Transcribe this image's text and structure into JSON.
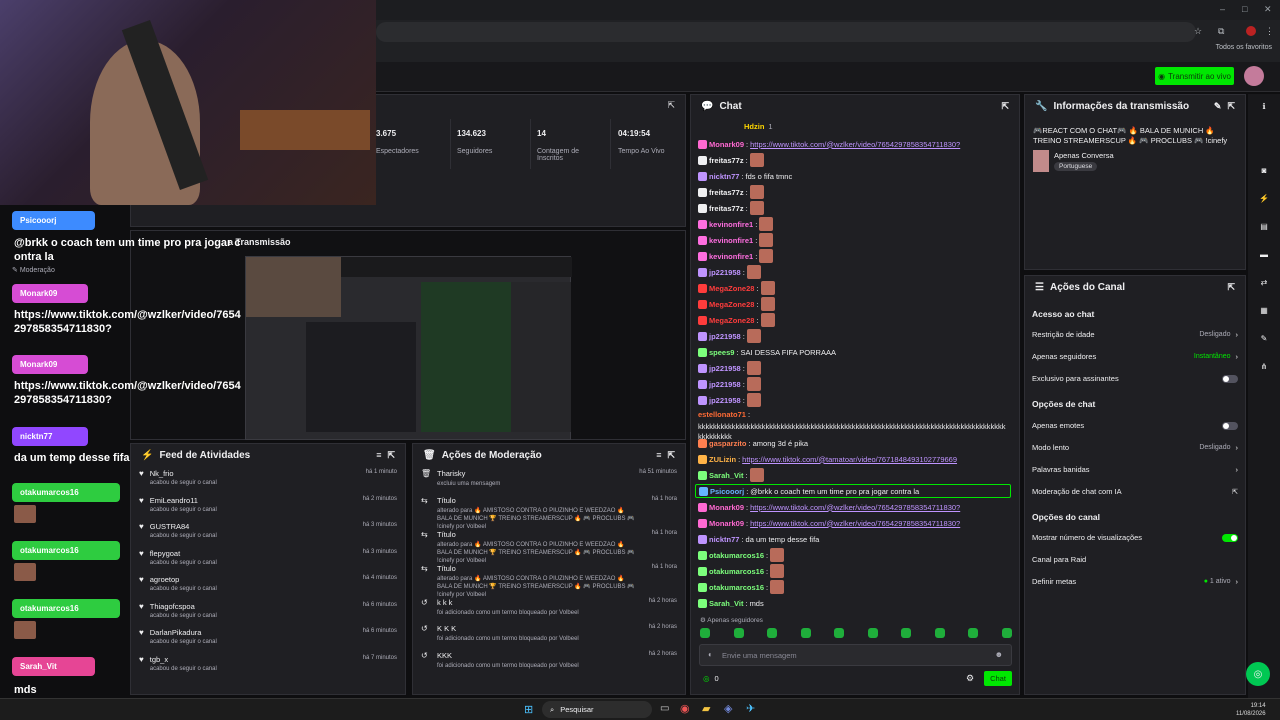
{
  "browser": {
    "bookmarks_label": "Todos os favoritos"
  },
  "appbar": {
    "live_button": "Transmitir ao vivo"
  },
  "stats": [
    {
      "value": "3.675",
      "label": "Espectadores"
    },
    {
      "value": "134.623",
      "label": "Seguidores"
    },
    {
      "value": "14",
      "label": "Contagem de Inscritos"
    },
    {
      "value": "04:19:54",
      "label": "Tempo Ao Vivo"
    }
  ],
  "preview": {
    "title": "a Transmissão",
    "mod_label": "Moderação"
  },
  "feed": {
    "title": "Feed de Atividades",
    "items": [
      {
        "name": "Nk_frio",
        "action": "acabou de seguir o canal",
        "time": "há 1 minuto"
      },
      {
        "name": "EmiLeandro11",
        "action": "acabou de seguir o canal",
        "time": "há 2 minutos"
      },
      {
        "name": "GUSTRA84",
        "action": "acabou de seguir o canal",
        "time": "há 3 minutos"
      },
      {
        "name": "flepygoat",
        "action": "acabou de seguir o canal",
        "time": "há 3 minutos"
      },
      {
        "name": "agroetop",
        "action": "acabou de seguir o canal",
        "time": "há 4 minutos"
      },
      {
        "name": "Thiagofcspoa",
        "action": "acabou de seguir o canal",
        "time": "há 6 minutos"
      },
      {
        "name": "DarlanPikadura",
        "action": "acabou de seguir o canal",
        "time": "há 6 minutos"
      },
      {
        "name": "tgb_x",
        "action": "acabou de seguir o canal",
        "time": "há 7 minutos"
      }
    ]
  },
  "moderation": {
    "title": "Ações de Moderação",
    "items": [
      {
        "name": "Tharisky",
        "detail": "excluiu uma mensagem",
        "time": "há 51 minutos"
      },
      {
        "name": "Título",
        "detail": "alterado para 🔥 AMISTOSO CONTRA O PIUZINHO E WEEDZAO 🔥 BALA DE MUNICH 🏆 TREINO STREAMERSCUP 🔥 🎮 PROCLUBS 🎮 !cinefy por Volbeel",
        "time": "há 1 hora"
      },
      {
        "name": "Título",
        "detail": "alterado para 🔥 AMISTOSO CONTRA O PIUZINHO E WEEDZAO 🔥 BALA DE MUNICH 🏆 TREINO STREAMERSCUP 🔥 🎮 PROCLUBS 🎮 !cinefy por Volbeel",
        "time": "há 1 hora"
      },
      {
        "name": "Título",
        "detail": "alterado para 🔥 AMISTOSO CONTRA O PIUZINHO E WEEDZAO 🔥 BALA DE MUNICH 🏆 TREINO STREAMERSCUP 🔥 🎮 PROCLUBS 🎮 !cinefy por Volbeel",
        "time": "há 1 hora"
      },
      {
        "name": "k k k",
        "detail": "foi adicionado como um termo bloqueado por Volbeel",
        "time": "há 2 horas"
      },
      {
        "name": "K K K",
        "detail": "foi adicionado como um termo bloqueado por Volbeel",
        "time": "há 2 horas"
      },
      {
        "name": "KKK",
        "detail": "foi adicionado como um termo bloqueado por Volbeel",
        "time": "há 2 horas"
      }
    ]
  },
  "chat": {
    "title": "Chat",
    "pinned_user": "Hdzin",
    "pinned_count": "1",
    "lines": [
      {
        "user": "Monark09",
        "color": "#ff69d2",
        "text": "https://www.tiktok.com/@wzlker/video/7654297858354711830?",
        "link": true
      },
      {
        "user": "freitas77z",
        "color": "#efeff1",
        "text": "",
        "emote": true
      },
      {
        "user": "nicktn77",
        "color": "#bf94ff",
        "text": "fds o fifa tmnc"
      },
      {
        "user": "freitas77z",
        "color": "#efeff1",
        "text": "",
        "emote": true
      },
      {
        "user": "freitas77z",
        "color": "#efeff1",
        "text": "",
        "emote": true
      },
      {
        "user": "kevinonfire1",
        "color": "#ff6ee0",
        "text": "",
        "emote": true
      },
      {
        "user": "kevinonfire1",
        "color": "#ff6ee0",
        "text": "",
        "emote": true
      },
      {
        "user": "kevinonfire1",
        "color": "#ff6ee0",
        "text": "",
        "emote": true
      },
      {
        "user": "jp221958",
        "color": "#bf94ff",
        "text": "",
        "emote": true
      },
      {
        "user": "MegaZone28",
        "color": "#ff3c3c",
        "text": "",
        "emote": true
      },
      {
        "user": "MegaZone28",
        "color": "#ff3c3c",
        "text": "",
        "emote": true
      },
      {
        "user": "MegaZone28",
        "color": "#ff3c3c",
        "text": "",
        "emote": true
      },
      {
        "user": "jp221958",
        "color": "#bf94ff",
        "text": "",
        "emote": true
      },
      {
        "user": "spees9",
        "color": "#7cff7c",
        "text": "SAI DESSA FIFA PORRAAA"
      },
      {
        "user": "jp221958",
        "color": "#bf94ff",
        "text": "",
        "emote": true
      },
      {
        "user": "jp221958",
        "color": "#bf94ff",
        "text": "",
        "emote": true
      },
      {
        "user": "jp221958",
        "color": "#bf94ff",
        "text": "",
        "emote": true
      }
    ],
    "lines2": [
      {
        "user": "gasparzito",
        "color": "#ff7f50",
        "text": "among 3d é pika"
      },
      {
        "user": "ZULizin",
        "color": "#ffb347",
        "text": "https://www.tiktok.com/@tamatoar/video/7671848493102779669",
        "link": true
      },
      {
        "user": "Sarah_Vit",
        "color": "#7cff7c",
        "text": "",
        "emote": true
      },
      {
        "user": "Psicooorj",
        "color": "#66b3ff",
        "text": "@brkk o coach tem um time pro pra jogar contra la",
        "highlight": true
      },
      {
        "user": "Monark09",
        "color": "#ff69d2",
        "text": "https://www.tiktok.com/@wzlker/video/7654297858354711830?",
        "link": true
      },
      {
        "user": "Monark09",
        "color": "#ff69d2",
        "text": "https://www.tiktok.com/@wzlker/video/7654297858354711830?",
        "link": true
      },
      {
        "user": "nicktn77",
        "color": "#bf94ff",
        "text": "da um temp desse fifa"
      },
      {
        "user": "otakumarcos16",
        "color": "#7cff7c",
        "text": "",
        "emote": true
      },
      {
        "user": "otakumarcos16",
        "color": "#7cff7c",
        "text": "",
        "emote": true
      },
      {
        "user": "otakumarcos16",
        "color": "#7cff7c",
        "text": "",
        "emote": true
      },
      {
        "user": "Sarah_Vit",
        "color": "#7cff7c",
        "text": "mds"
      }
    ],
    "spam_user": "estellonato71",
    "spam_text": "kkkkkkkkkkkkkkkkkkkkkkkkkkkkkkkkkkkkkkkkkkkkkkkkkkkkkkkkkkkkkkkkkkkkkkkkkkkkkkkkkkkkkkkkkkk",
    "followers_only": "Apenas seguidores",
    "input_placeholder": "Envie uma mensagem",
    "points": "0",
    "send_label": "Chat"
  },
  "stream_info": {
    "title": "Informações da transmissão",
    "stream_title": "🎮REACT COM O CHAT🎮 🔥 BALA DE MUNICH 🔥 TREINO STREAMERSCUP 🔥 🎮 PROCLUBS 🎮 !cinefy",
    "category": "Apenas Conversa",
    "language": "Portuguese"
  },
  "channel_actions": {
    "title": "Ações do Canal",
    "chat_access": "Acesso ao chat",
    "age_restriction": "Restrição de idade",
    "age_value": "Desligado",
    "followers_only": "Apenas seguidores",
    "followers_value": "Instantâneo",
    "subs_only": "Exclusivo para assinantes",
    "chat_options": "Opções de chat",
    "emotes_only": "Apenas emotes",
    "slow_mode": "Modo lento",
    "slow_value": "Desligado",
    "banned_words": "Palavras banidas",
    "ai_mod": "Moderação de chat com IA",
    "channel_options": "Opções do canal",
    "show_viewers": "Mostrar número de visualizações",
    "raid": "Canal para Raid",
    "goals": "Definir metas",
    "goals_value": "1 ativo"
  },
  "overlay": [
    {
      "name": "Psicooorj",
      "msg": "@brkk o coach tem um time pro pra jogar contra la",
      "color": "#3d8bff"
    },
    {
      "name": "Monark09",
      "msg": "https://www.tiktok.com/@wzlker/video/7654297858354711830?",
      "color": "#d64cd4"
    },
    {
      "name": "Monark09",
      "msg": "https://www.tiktok.com/@wzlker/video/7654297858354711830?",
      "color": "#d64cd4"
    },
    {
      "name": "nicktn77",
      "msg": "da um temp desse fifa",
      "color": "#9147ff"
    },
    {
      "name": "otakumarcos16",
      "msg": "",
      "color": "#2ecc40"
    },
    {
      "name": "otakumarcos16",
      "msg": "",
      "color": "#2ecc40"
    },
    {
      "name": "otakumarcos16",
      "msg": "",
      "color": "#2ecc40"
    },
    {
      "name": "Sarah_Vit",
      "msg": "mds",
      "color": "#e64595"
    }
  ],
  "taskbar": {
    "search": "Pesquisar",
    "time": "19:14",
    "date": "11/08/2026"
  },
  "colors": {
    "accent": "#00e701",
    "link": "#bf94ff"
  }
}
